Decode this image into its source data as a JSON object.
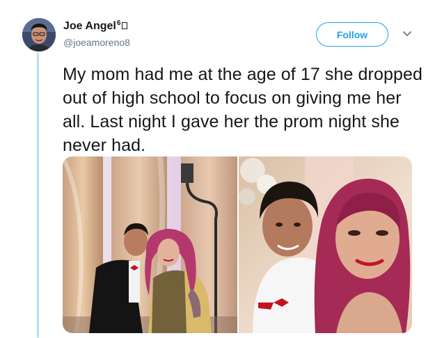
{
  "author": {
    "display_name": "Joe Angel",
    "name_suffix": "6",
    "handle": "@joeamoreno8"
  },
  "actions": {
    "follow_label": "Follow",
    "menu_icon": "chevron-down-icon"
  },
  "tweet": {
    "text": "My mom had me at the age of 17 she dropped out of high school to focus on giving me her all. Last night I gave her the prom night she never had."
  },
  "media": {
    "photos": [
      {
        "name": "prom-photo-full-length"
      },
      {
        "name": "prom-photo-selfie"
      }
    ]
  },
  "colors": {
    "accent": "#1da1f2",
    "thread_line": "#b7dff5",
    "text_primary": "#14171a",
    "text_secondary": "#657786"
  }
}
